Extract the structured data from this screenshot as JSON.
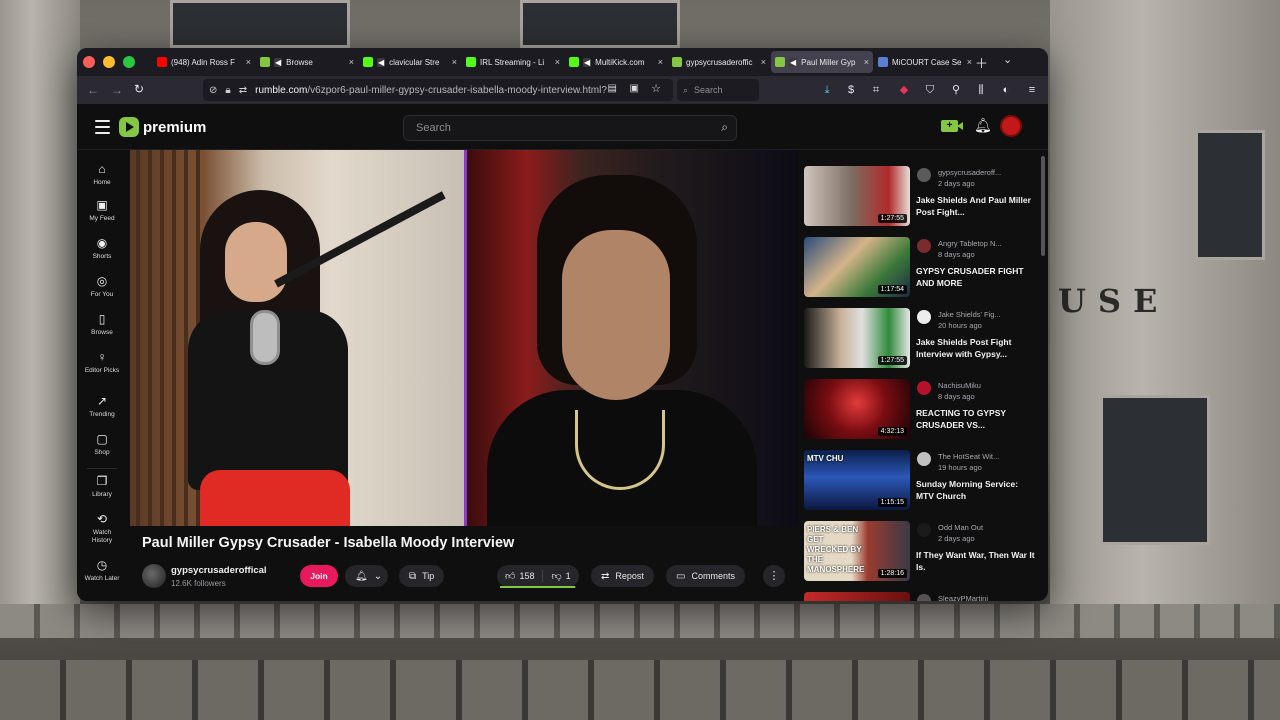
{
  "background": {
    "sign_text": "USE"
  },
  "browser": {
    "tabs": [
      {
        "label": "(948) Adin Ross F",
        "icon": "youtube-icon",
        "color": "#ff0000",
        "muted": false,
        "active": false
      },
      {
        "label": "Browse",
        "icon": "rumble-icon",
        "color": "#85c742",
        "muted": true,
        "active": false
      },
      {
        "label": "clavicular Stre",
        "icon": "kick-icon",
        "color": "#53fc18",
        "muted": true,
        "active": false
      },
      {
        "label": "IRL Streaming - Li",
        "icon": "kick-icon",
        "color": "#53fc18",
        "muted": false,
        "active": false
      },
      {
        "label": "MultiKick.com",
        "icon": "multikick-icon",
        "color": "#53fc18",
        "muted": true,
        "active": false
      },
      {
        "label": "gypsycrusaderoffic",
        "icon": "rumble-icon",
        "color": "#85c742",
        "muted": false,
        "active": false
      },
      {
        "label": "Paul Miller Gyp",
        "icon": "rumble-icon",
        "color": "#85c742",
        "muted": true,
        "active": true
      },
      {
        "label": "MiCOURT Case Se",
        "icon": "court-icon",
        "color": "#5c7fd6",
        "muted": false,
        "active": false
      }
    ],
    "url_domain": "rumble.com",
    "url_path": "/v6zpor6-paul-miller-gypsy-crusader-isabella-moody-interview.html?",
    "search_placeholder": "Search"
  },
  "rumble": {
    "logo_text": "premium",
    "search_placeholder": "Search",
    "sidebar": [
      {
        "label": "Home",
        "icon": "⌂",
        "name": "home"
      },
      {
        "label": "My Feed",
        "icon": "▣",
        "name": "my-feed"
      },
      {
        "label": "Shorts",
        "icon": "◉",
        "name": "shorts"
      },
      {
        "label": "For You",
        "icon": "◎",
        "name": "for-you"
      },
      {
        "label": "Browse",
        "icon": "▯",
        "name": "browse"
      },
      {
        "label": "Editor Picks",
        "icon": "♀",
        "name": "editor-picks"
      },
      {
        "label": "Trending",
        "icon": "↗",
        "name": "trending"
      },
      {
        "label": "Shop",
        "icon": "▢",
        "name": "shop"
      },
      {
        "label": "Library",
        "icon": "❐",
        "name": "library"
      },
      {
        "label": "Watch History",
        "icon": "⟲",
        "name": "watch-history"
      },
      {
        "label": "Watch Later",
        "icon": "◷",
        "name": "watch-later"
      }
    ],
    "video": {
      "title": "Paul Miller Gypsy Crusader - Isabella Moody Interview",
      "channel": "gypsycrusaderoffical",
      "followers": "12.6K followers",
      "join_label": "Join",
      "tip_label": "Tip",
      "likes": "158",
      "dislikes": "1",
      "like_ratio": 0.99,
      "repost_label": "Repost",
      "comments_label": "Comments"
    },
    "recommended": [
      {
        "channel": "gypsycrusaderoff...",
        "age": "2 days ago",
        "title": "Jake Shields And Paul Miller Post Fight...",
        "duration": "1:27:55",
        "thumb": "linear-gradient(90deg,#cfc6bd 0%,#7d6d62 45%,#b12a2a 80%,#e7e0da 100%)",
        "avatar": "#5b5b5b"
      },
      {
        "channel": "Angry Tabletop N...",
        "age": "8 days ago",
        "title": "GYPSY CRUSADER FIGHT AND MORE",
        "duration": "1:17:54",
        "thumb": "linear-gradient(135deg,#2a4c7a 0%,#d4b48a 40%,#3d7a3a 70%,#1c2a44 100%)",
        "avatar": "#7a2b2b"
      },
      {
        "channel": "Jake Shields' Fig...",
        "age": "20 hours ago",
        "title": "Jake Shields Post Fight Interview with Gypsy...",
        "duration": "1:27:55",
        "thumb": "linear-gradient(90deg,#1a1a1a 0%,#c9b29a 35%,#e0e0e0 55%,#2f8a3a 80%,#e8e8e8 100%)",
        "avatar": "#ededed"
      },
      {
        "channel": "NachisuMiku",
        "age": "8 days ago",
        "title": "REACTING TO GYPSY CRUSADER VS...",
        "duration": "4:32:13",
        "thumb": "radial-gradient(circle at 50% 40%,#e23b3b 0%,#7a0d12 45%,#1a0306 100%)",
        "avatar": "#b3122a"
      },
      {
        "channel": "The HotSeat Wit...",
        "age": "19 hours ago",
        "title": "Sunday Morning Service: MTV Church",
        "duration": "1:15:15",
        "thumb": "linear-gradient(180deg,#0a1f4a 0%,#2c58b8 45%,#0c1740 100%)",
        "avatar": "#c1c1c1",
        "overlay": "MTV CHU"
      },
      {
        "channel": "Odd Man Out",
        "age": "2 days ago",
        "title": "If They Want War, Then War It Is.",
        "duration": "1:28:16",
        "thumb": "linear-gradient(90deg,#e4d9c4 0%,#e4d9c4 45%,#9b3b2f 60%,#3a3a48 100%)",
        "avatar": "#1b1b1b",
        "overlay": "PIERS & BEN GET WRECKED BY THE MANOSPHERE"
      },
      {
        "channel": "SleazyPMartini",
        "age": "",
        "title": "",
        "duration": "",
        "thumb": "linear-gradient(90deg,#c52a2a,#6a0f0f)",
        "avatar": "#555"
      }
    ]
  }
}
